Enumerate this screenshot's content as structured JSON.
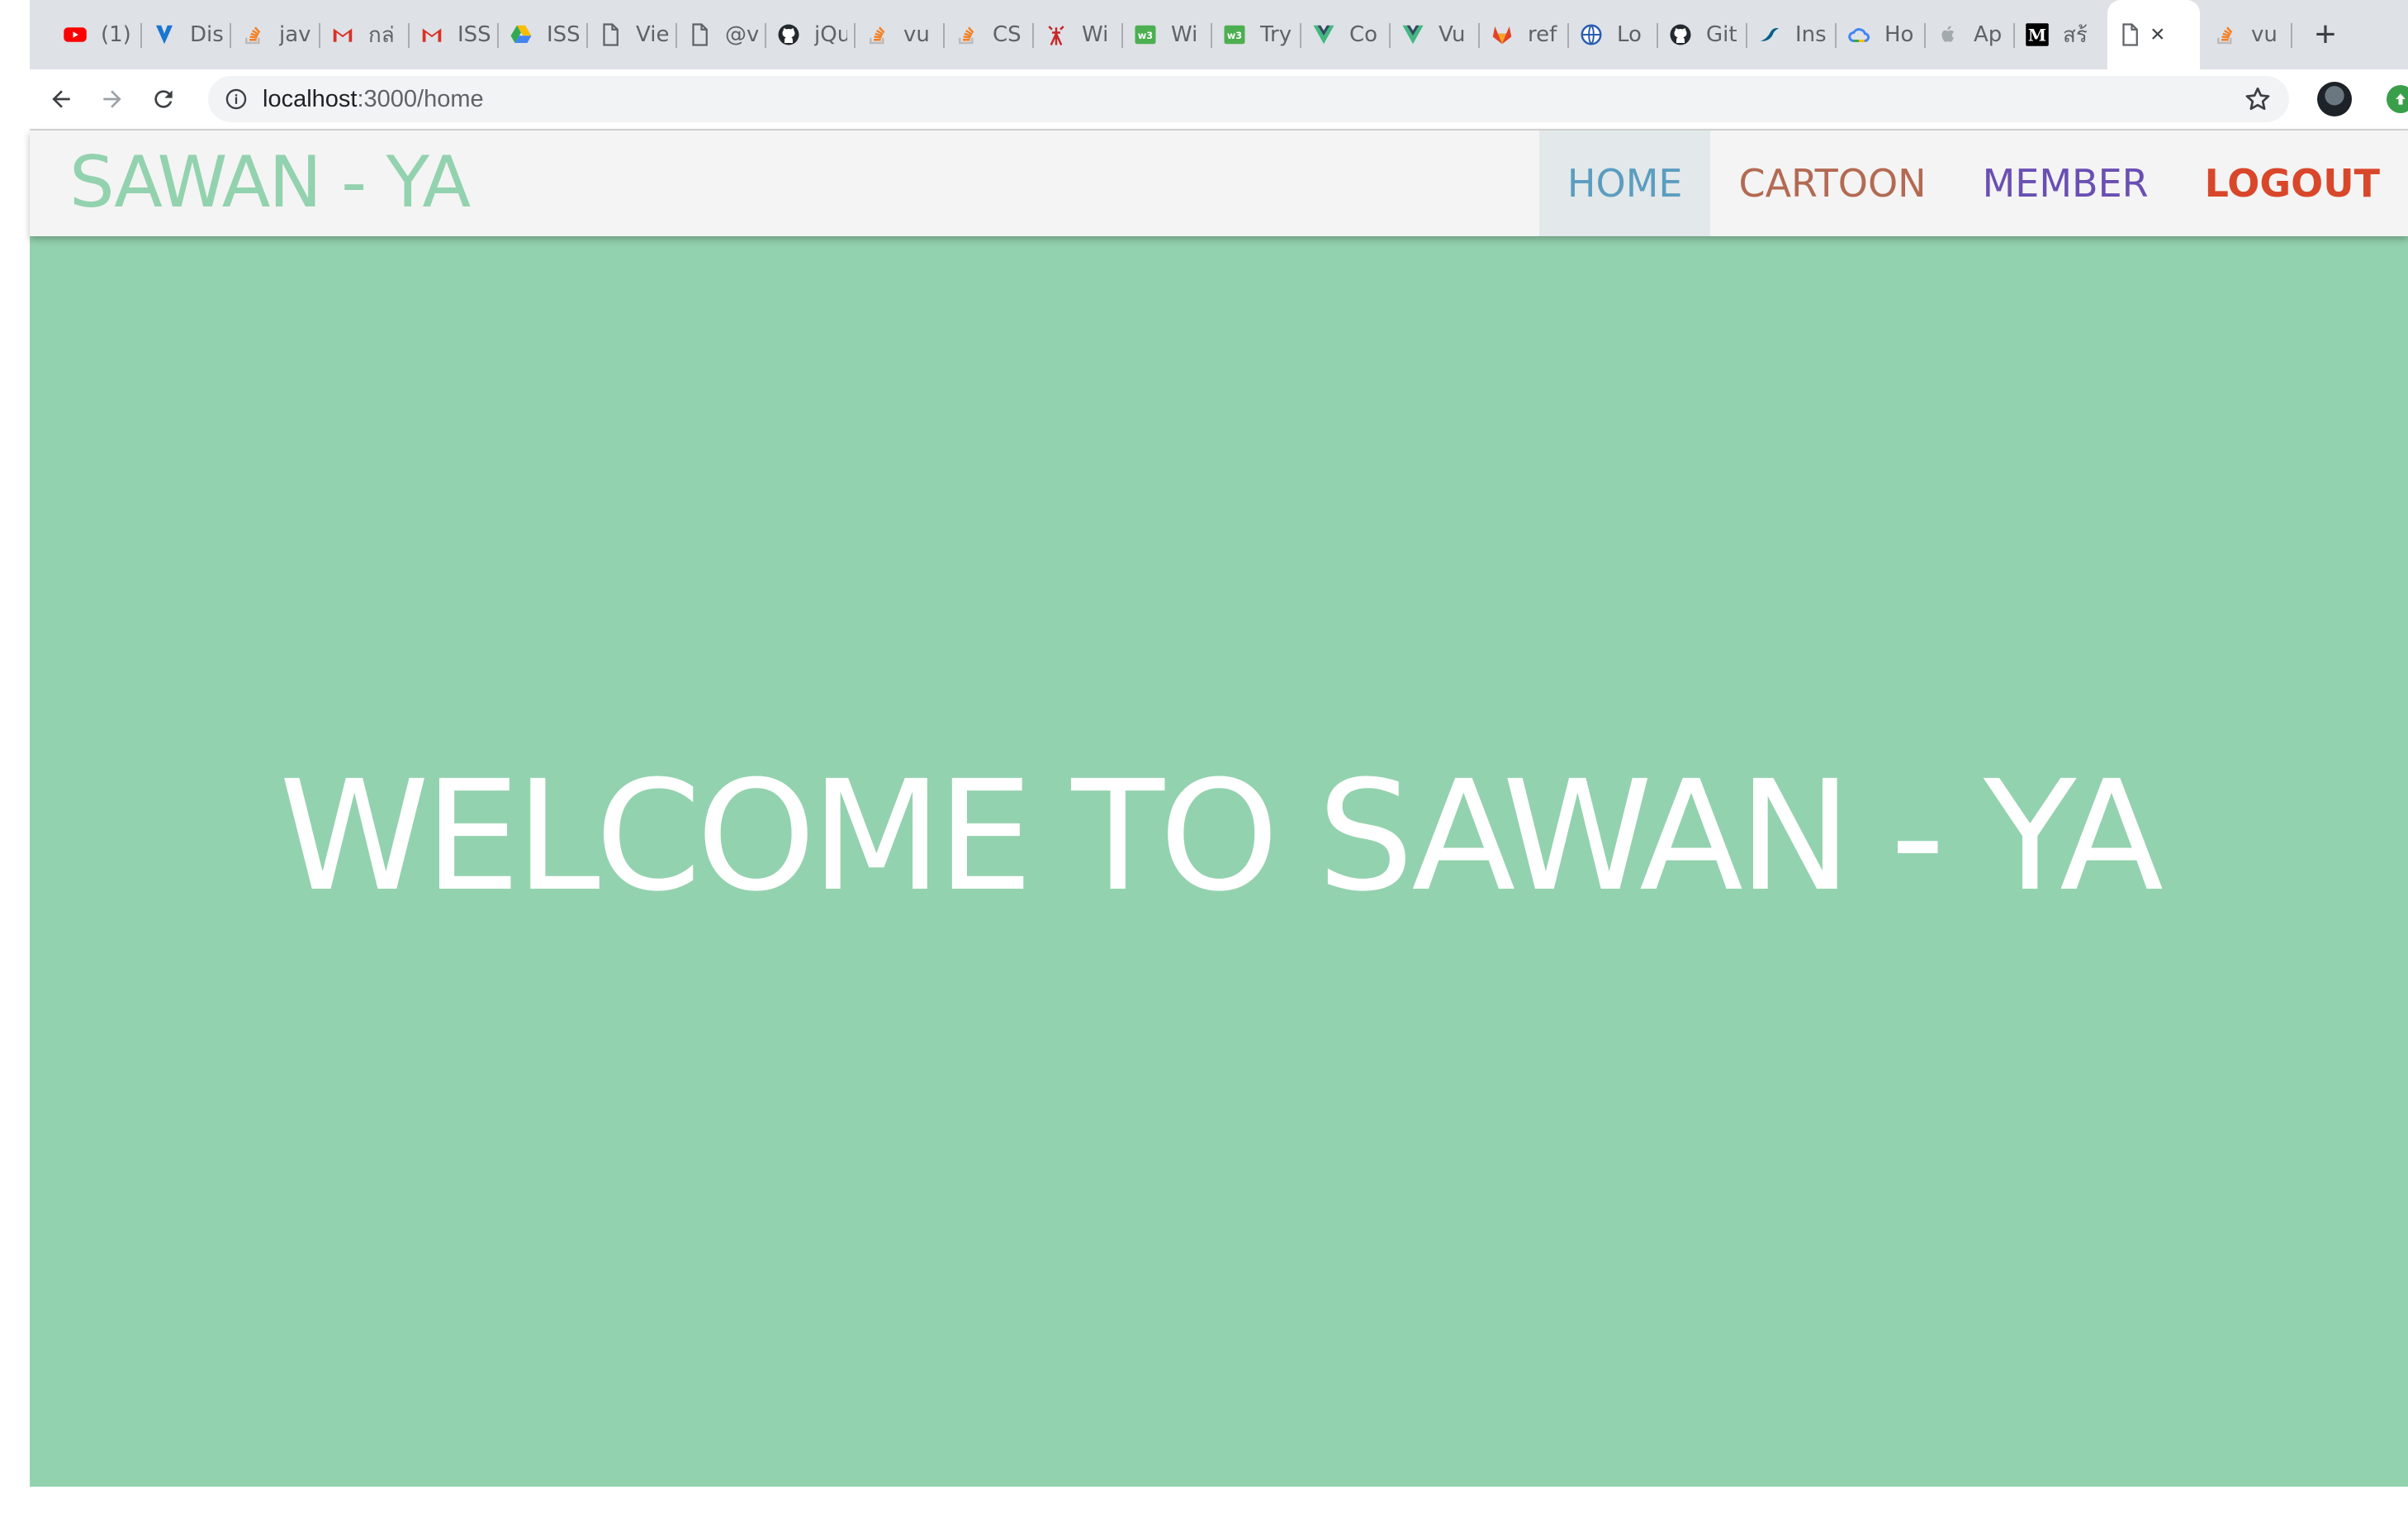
{
  "browser": {
    "tabs": [
      {
        "title": "(1)",
        "icon": "youtube-icon",
        "color": "#ff0000"
      },
      {
        "title": "Dis",
        "icon": "vuetify-icon",
        "color": "#1976d2"
      },
      {
        "title": "jav",
        "icon": "stackoverflow-icon",
        "color": "#f48024"
      },
      {
        "title": "กล่",
        "icon": "gmail-icon",
        "color": "#d93025"
      },
      {
        "title": "ISS",
        "icon": "gmail-icon",
        "color": "#d93025"
      },
      {
        "title": "ISS",
        "icon": "google-drive-icon",
        "color": "#34a853"
      },
      {
        "title": "Vie",
        "icon": "document-icon",
        "color": "#5f6368"
      },
      {
        "title": "@v",
        "icon": "document-icon",
        "color": "#5f6368"
      },
      {
        "title": "jQu",
        "icon": "github-icon",
        "color": "#24292e"
      },
      {
        "title": "vu",
        "icon": "stackoverflow-icon",
        "color": "#f48024"
      },
      {
        "title": "CS",
        "icon": "stackoverflow-icon",
        "color": "#f48024"
      },
      {
        "title": "Wi",
        "icon": "antenna-icon",
        "color": "#c62828"
      },
      {
        "title": "Wi",
        "icon": "w3schools-icon",
        "color": "#4caf50"
      },
      {
        "title": "Try",
        "icon": "w3schools-icon",
        "color": "#4caf50"
      },
      {
        "title": "Co",
        "icon": "vue-icon",
        "color": "#41b883"
      },
      {
        "title": "Vu",
        "icon": "vue-icon",
        "color": "#41b883"
      },
      {
        "title": "ref",
        "icon": "gitlab-icon",
        "color": "#e24329"
      },
      {
        "title": "Lo",
        "icon": "globe-icon",
        "color": "#2a5db0"
      },
      {
        "title": "Git",
        "icon": "github-icon",
        "color": "#24292e"
      },
      {
        "title": "Ins",
        "icon": "mysql-icon",
        "color": "#00618a"
      },
      {
        "title": "Ho",
        "icon": "google-cloud-icon",
        "color": "#4285f4"
      },
      {
        "title": "Ap",
        "icon": "apple-icon",
        "color": "#a2aaad"
      },
      {
        "title": "สร้",
        "icon": "medium-icon",
        "color": "#000000"
      },
      {
        "title": "",
        "icon": "document-icon",
        "color": "#5f6368",
        "active": true
      },
      {
        "title": "vu",
        "icon": "stackoverflow-icon",
        "color": "#f48024"
      }
    ],
    "url_host": "localhost",
    "url_path": ":3000/home"
  },
  "navbar": {
    "brand": "SAWAN - YA",
    "items": [
      {
        "label": "HOME",
        "color": "#5b9dc0",
        "active": true
      },
      {
        "label": "CARTOON",
        "color": "#b36a52"
      },
      {
        "label": "MEMBER",
        "color": "#6a4fb3"
      },
      {
        "label": "LOGOUT",
        "color": "#d9472b"
      }
    ]
  },
  "hero": {
    "title": "WELCOME TO SAWAN - YA"
  },
  "colors": {
    "brand": "#93d2ae",
    "hero_bg": "#93d2ae",
    "navbar_bg": "#f4f4f4"
  }
}
